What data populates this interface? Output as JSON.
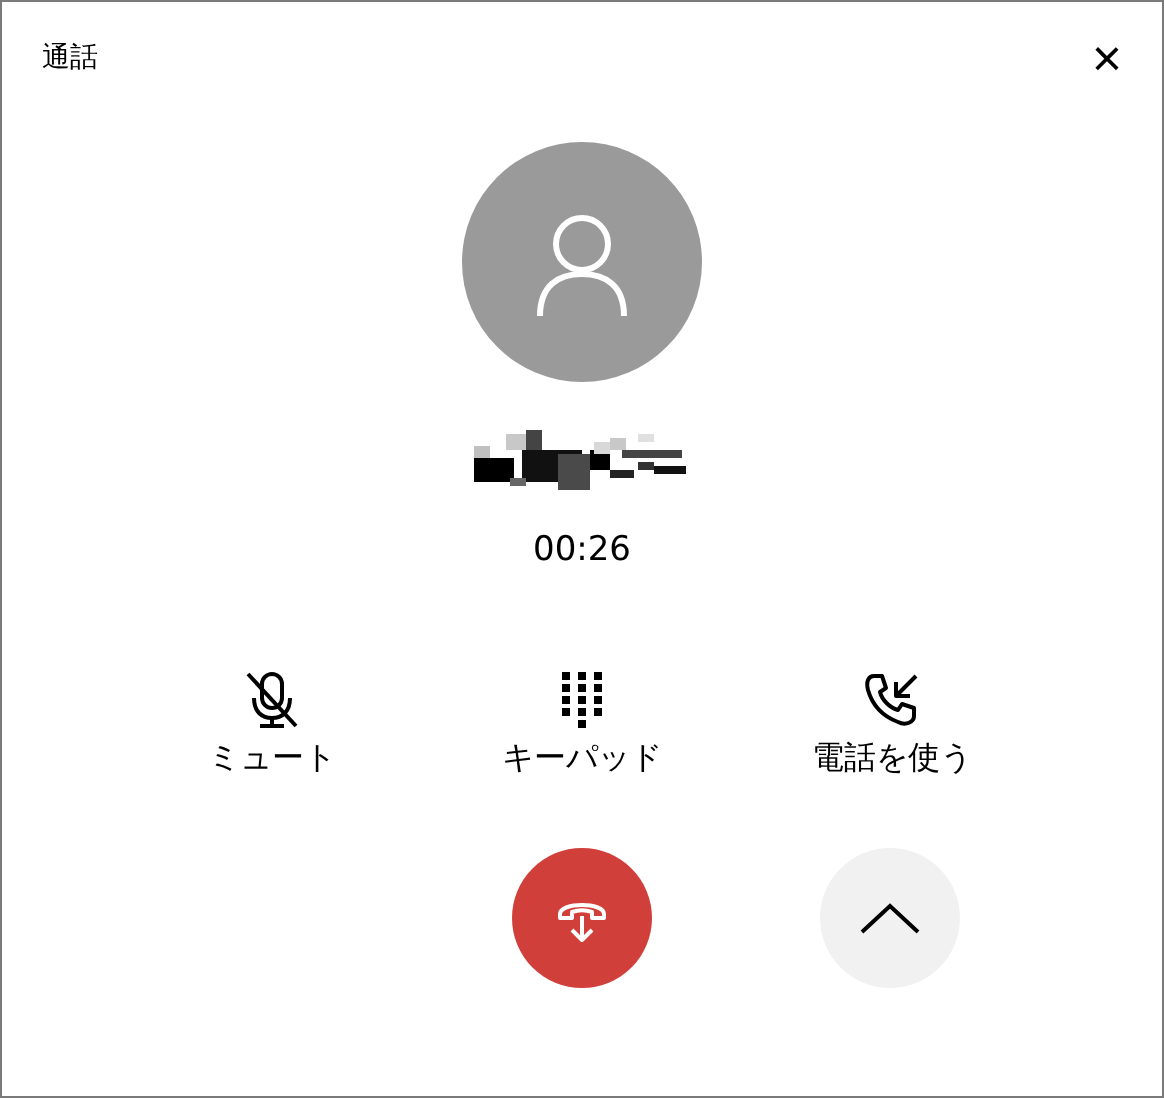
{
  "window": {
    "title": "通話",
    "close": "×"
  },
  "call": {
    "duration": "00:26"
  },
  "actions": [
    {
      "kind": "mute",
      "label": "ミュート"
    },
    {
      "kind": "keypad",
      "label": "キーパッド"
    },
    {
      "kind": "phone",
      "label": "電話を使う"
    }
  ]
}
